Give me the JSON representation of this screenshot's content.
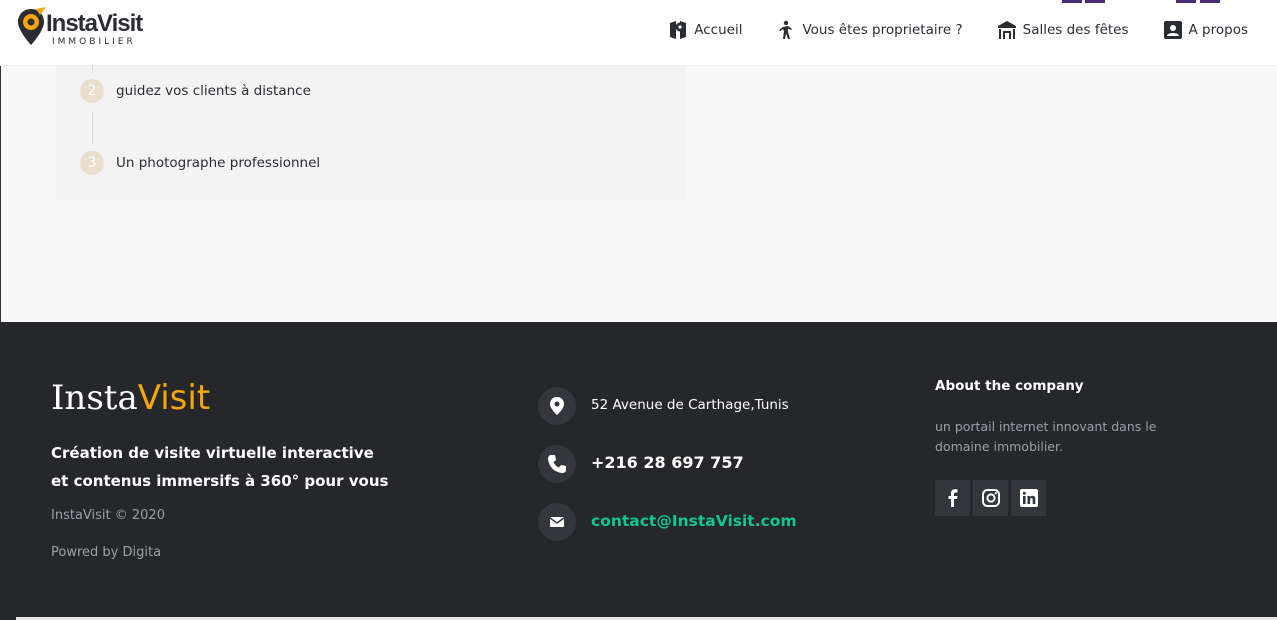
{
  "header": {
    "logo_brand": "InstaVisit",
    "logo_sub": "IMMOBILIER",
    "nav": [
      {
        "label": "Accueil",
        "icon": "map-marker-icon"
      },
      {
        "label": "Vous êtes proprietaire ?",
        "icon": "person-icon"
      },
      {
        "label": "Salles des fêtes",
        "icon": "building-icon"
      },
      {
        "label": "A propos",
        "icon": "contact-card-icon"
      }
    ]
  },
  "steps": [
    {
      "number": "2",
      "text": "guidez vos clients à distance"
    },
    {
      "number": "3",
      "text": "Un photographe professionnel"
    }
  ],
  "footer": {
    "brand_left": "Insta",
    "brand_right": "Visit",
    "tagline_1": "Création de visite virtuelle interactive",
    "tagline_2": "et contenus immersifs à 360° pour vous",
    "copyright": "InstaVisit © 2020",
    "powered": "Powred by Digita",
    "address": "52 Avenue de Carthage,Tunis",
    "phone": "+216 28 697 757",
    "email": "contact@InstaVisit.com",
    "about_title": "About the company",
    "about_text": "un portail internet innovant dans le domaine immobilier.",
    "social": [
      "facebook-icon",
      "instagram-icon",
      "linkedin-icon"
    ]
  },
  "colors": {
    "accent_orange": "#f6a609",
    "email_green": "#10c88a",
    "footer_bg": "#25272b"
  }
}
